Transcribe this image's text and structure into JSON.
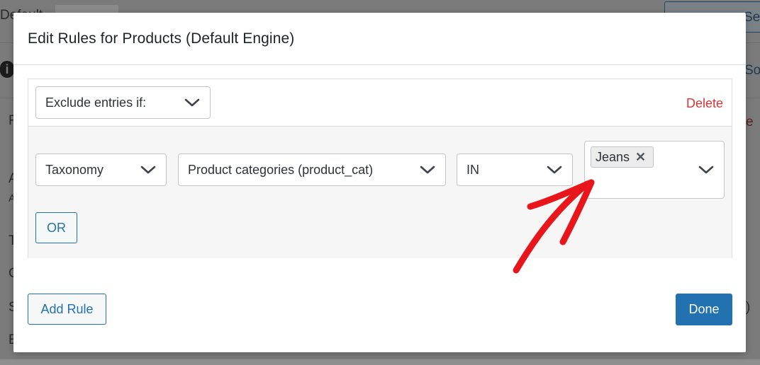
{
  "background": {
    "title_fragment": "Default",
    "button_fragment": "Set",
    "link_fragment": "So",
    "side_fragment": "e",
    "left_letters": [
      "R",
      "A",
      "A",
      "T",
      "C",
      "S",
      "E"
    ],
    "right_fragment": ")"
  },
  "modal": {
    "title": "Edit Rules for Products (Default Engine)",
    "rule": {
      "mode_select": {
        "value": "Exclude entries if:"
      },
      "delete_label": "Delete",
      "condition": {
        "type_select": {
          "value": "Taxonomy"
        },
        "taxonomy_select": {
          "value": "Product categories (product_cat)"
        },
        "operator_select": {
          "value": "IN"
        },
        "terms": {
          "tags": [
            "Jeans"
          ],
          "remove_glyph": "✕"
        }
      },
      "or_button": "OR"
    },
    "add_rule_button": "Add Rule",
    "done_button": "Done"
  },
  "colors": {
    "primary": "#2271b1",
    "danger": "#d63638",
    "annotation_arrow": "#e8151b"
  },
  "icons": {
    "chevron": "chevron-down-icon",
    "remove": "close-icon",
    "info": "info-icon",
    "annotation": "arrow-annotation"
  }
}
